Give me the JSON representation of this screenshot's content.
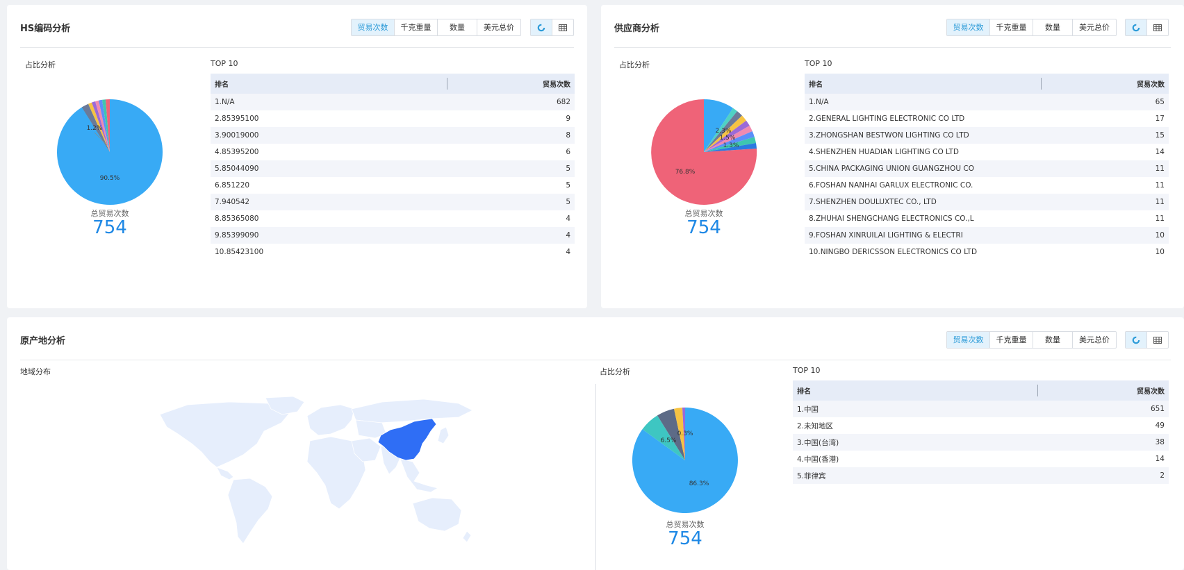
{
  "tabs": [
    "贸易次数",
    "千克重量",
    "数量",
    "美元总价"
  ],
  "hs": {
    "title": "HS编码分析",
    "share_label": "占比分析",
    "top_label": "TOP 10",
    "total_label": "总贸易次数",
    "total_value": "754",
    "col_rank": "排名",
    "col_count": "贸易次数",
    "pie_labels": [
      "90.5%",
      "1.2%"
    ],
    "rows": [
      {
        "name": "1.N/A",
        "value": "682"
      },
      {
        "name": "2.85395100",
        "value": "9"
      },
      {
        "name": "3.90019000",
        "value": "8"
      },
      {
        "name": "4.85395200",
        "value": "6"
      },
      {
        "name": "5.85044090",
        "value": "5"
      },
      {
        "name": "6.851220",
        "value": "5"
      },
      {
        "name": "7.940542",
        "value": "5"
      },
      {
        "name": "8.85365080",
        "value": "4"
      },
      {
        "name": "9.85399090",
        "value": "4"
      },
      {
        "name": "10.85423100",
        "value": "4"
      }
    ]
  },
  "supplier": {
    "title": "供应商分析",
    "share_label": "占比分析",
    "top_label": "TOP 10",
    "total_label": "总贸易次数",
    "total_value": "754",
    "col_rank": "排名",
    "col_count": "贸易次数",
    "pie_labels": [
      "76.8%",
      "2.3%",
      "1.5%",
      "1.3%"
    ],
    "rows": [
      {
        "name": "1.N/A",
        "value": "65"
      },
      {
        "name": "2.GENERAL LIGHTING ELECTRONIC CO LTD",
        "value": "17"
      },
      {
        "name": "3.ZHONGSHAN BESTWON LIGHTING CO LTD",
        "value": "15"
      },
      {
        "name": "4.SHENZHEN HUADIAN LIGHTING CO LTD",
        "value": "14"
      },
      {
        "name": "5.CHINA PACKAGING UNION GUANGZHOU CO",
        "value": "11"
      },
      {
        "name": "6.FOSHAN NANHAI GARLUX ELECTRONIC CO.",
        "value": "11"
      },
      {
        "name": "7.SHENZHEN DOULUXTEC CO., LTD",
        "value": "11"
      },
      {
        "name": "8.ZHUHAI SHENGCHANG ELECTRONICS CO.,L",
        "value": "11"
      },
      {
        "name": "9.FOSHAN XINRUILAI LIGHTING & ELECTRI",
        "value": "10"
      },
      {
        "name": "10.NINGBO DERICSSON ELECTRONICS CO LTD",
        "value": "10"
      }
    ]
  },
  "origin": {
    "title": "原产地分析",
    "region_label": "地域分布",
    "share_label": "占比分析",
    "top_label": "TOP 10",
    "total_label": "总贸易次数",
    "total_value": "754",
    "col_rank": "排名",
    "col_count": "贸易次数",
    "pie_labels": [
      "86.3%",
      "6.5%",
      "0.3%"
    ],
    "rows": [
      {
        "name": "1.中国",
        "value": "651"
      },
      {
        "name": "2.未知地区",
        "value": "49"
      },
      {
        "name": "3.中国(台湾)",
        "value": "38"
      },
      {
        "name": "4.中国(香港)",
        "value": "14"
      },
      {
        "name": "5.菲律宾",
        "value": "2"
      }
    ]
  },
  "colors": {
    "accent": "#2c9bd8",
    "pie_main": "#38aaf5",
    "pie_pink": "#ef6378",
    "map_land": "#e6eefc",
    "map_china": "#2f6ef5"
  }
}
